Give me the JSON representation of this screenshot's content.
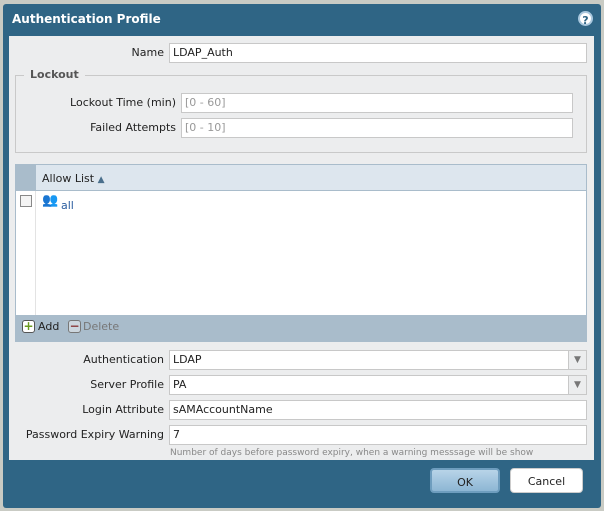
{
  "dialog": {
    "title": "Authentication Profile",
    "help_icon": "help-icon"
  },
  "name": {
    "label": "Name",
    "value": "LDAP_Auth"
  },
  "lockout": {
    "legend": "Lockout",
    "lockout_time_label": "Lockout Time (min)",
    "lockout_time_placeholder": "[0 - 60]",
    "failed_attempts_label": "Failed Attempts",
    "failed_attempts_placeholder": "[0 - 10]"
  },
  "allow_list": {
    "header": "Allow List",
    "sort": "ascending",
    "rows": [
      {
        "label": "all",
        "icon": "user-group-icon",
        "checked": false
      }
    ],
    "add_label": "Add",
    "delete_label": "Delete"
  },
  "authentication": {
    "label": "Authentication",
    "value": "LDAP"
  },
  "server_profile": {
    "label": "Server Profile",
    "value": "PA"
  },
  "login_attribute": {
    "label": "Login Attribute",
    "value": "sAMAccountName"
  },
  "password_expiry": {
    "label": "Password Expiry Warning",
    "value": "7",
    "hint": "Number of days before password expiry, when a warning messsage will be show"
  },
  "buttons": {
    "ok": "OK",
    "cancel": "Cancel"
  }
}
